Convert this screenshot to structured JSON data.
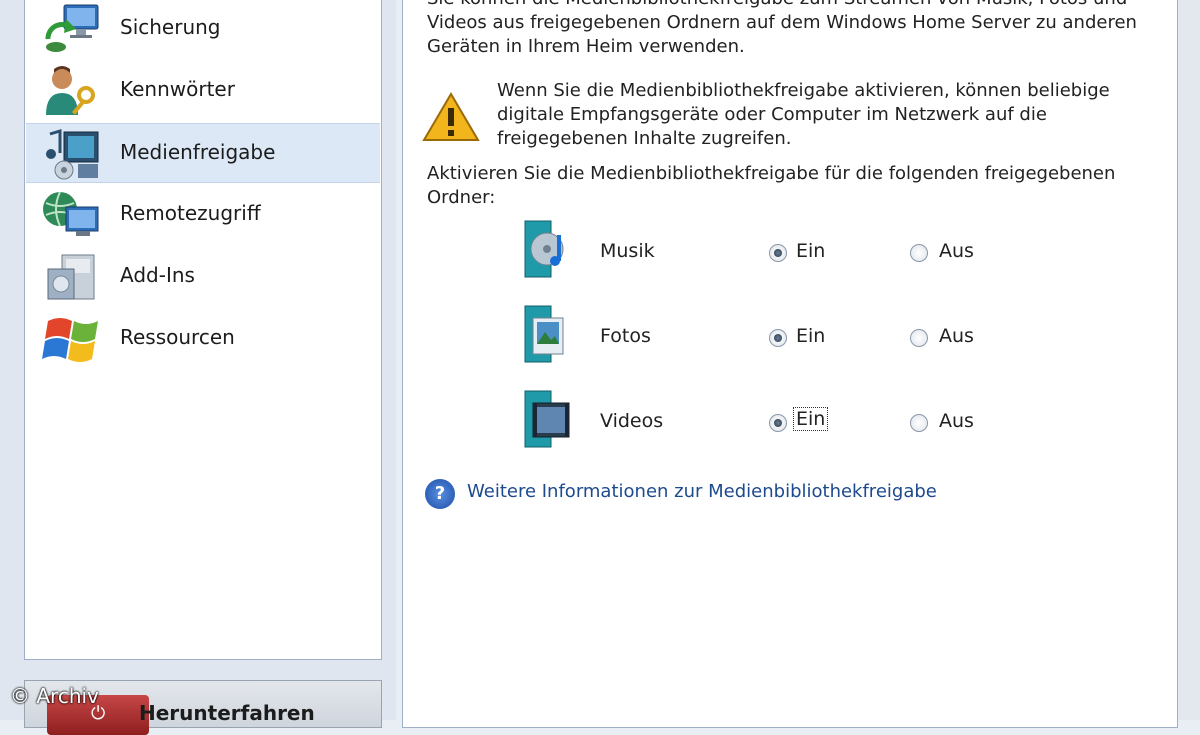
{
  "nav": {
    "items": [
      {
        "label": "Sicherung",
        "icon": "backup-computer-icon"
      },
      {
        "label": "Kennwörter",
        "icon": "user-key-icon"
      },
      {
        "label": "Medienfreigabe",
        "icon": "media-sharing-icon",
        "selected": true
      },
      {
        "label": "Remotezugriff",
        "icon": "globe-computer-icon"
      },
      {
        "label": "Add-Ins",
        "icon": "addins-box-icon"
      },
      {
        "label": "Ressourcen",
        "icon": "windows-logo-icon"
      }
    ]
  },
  "shutdown": {
    "label": "Herunterfahren",
    "icon_glyph": "⏻"
  },
  "watermark": "© Archiv",
  "content": {
    "intro": "Sie können die Medienbibliothekfreigabe zum Streamen von Musik, Fotos und Videos aus freigegebenen Ordnern auf dem Windows Home Server zu anderen Geräten in Ihrem Heim verwenden.",
    "warning": "Wenn Sie die Medienbibliothekfreigabe aktivieren, können beliebige digitale Empfangsgeräte oder Computer im Netzwerk auf die freigegebenen Inhalte zugreifen.",
    "activate_text": "Aktivieren Sie die Medienbibliothekfreigabe für die folgenden freigegebenen Ordner:",
    "folders": [
      {
        "name": "Musik",
        "on_label": "Ein",
        "off_label": "Aus",
        "value": "Ein"
      },
      {
        "name": "Fotos",
        "on_label": "Ein",
        "off_label": "Aus",
        "value": "Ein"
      },
      {
        "name": "Videos",
        "on_label": "Ein",
        "off_label": "Aus",
        "value": "Ein"
      }
    ],
    "help_link": "Weitere Informationen zur Medienbibliothekfreigabe",
    "help_icon_glyph": "?"
  },
  "colors": {
    "selection": "#dce8f6",
    "link": "#1d4a8e",
    "warning": "#f2b51c"
  }
}
